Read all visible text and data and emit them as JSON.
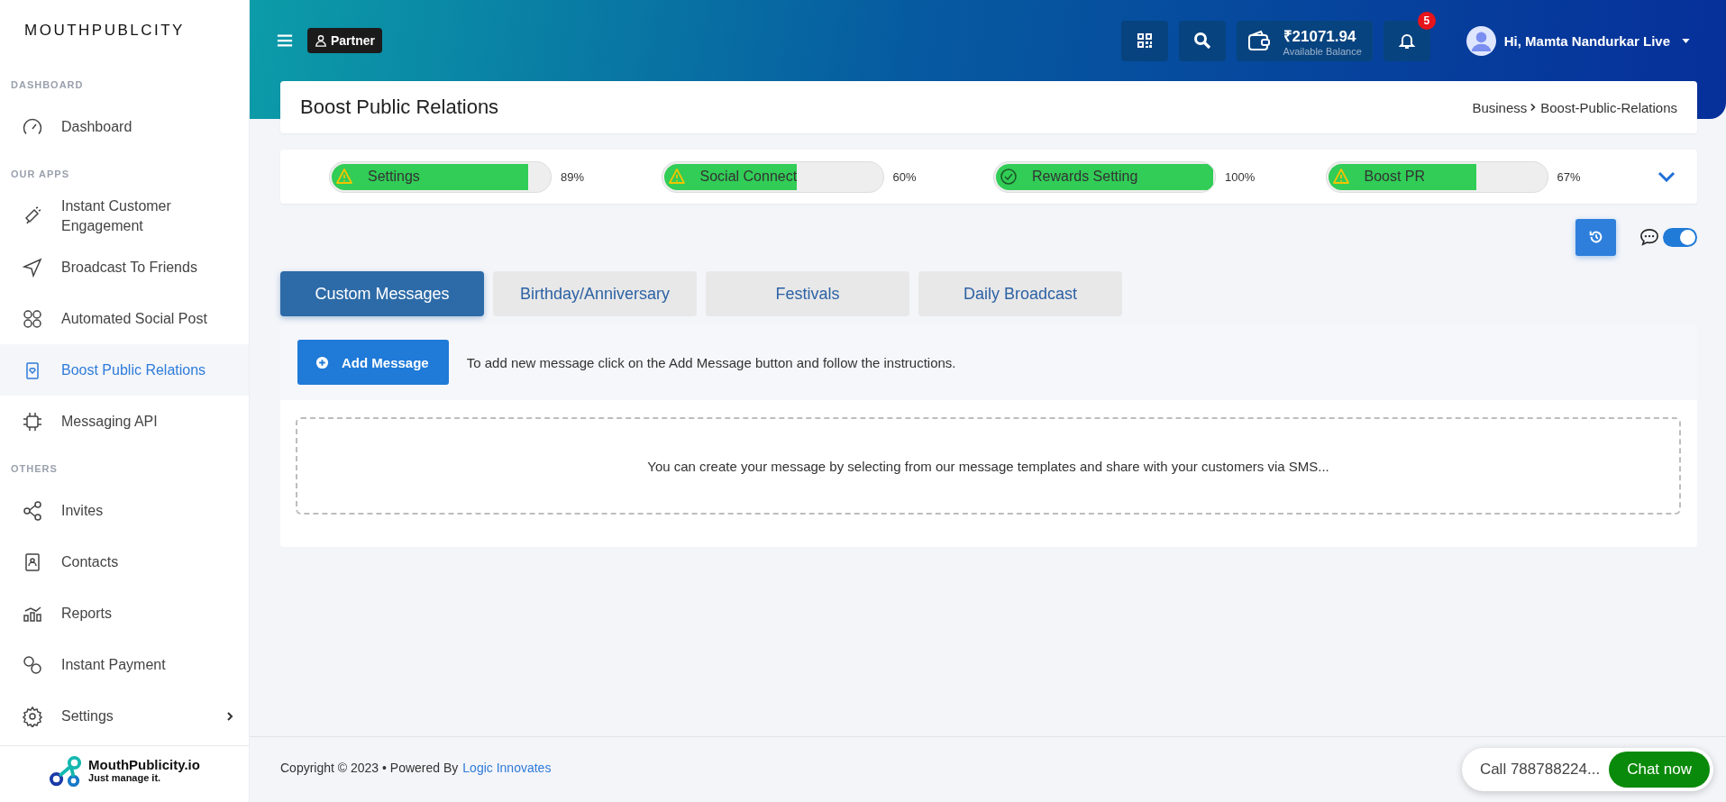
{
  "sidebar": {
    "logo": "MOUTHPUBLCITY",
    "sections": [
      {
        "heading": "DASHBOARD",
        "items": [
          {
            "label": "Dashboard",
            "selected": false,
            "submenu": false
          }
        ]
      },
      {
        "heading": "OUR APPS",
        "items": [
          {
            "label": "Instant Customer Engagement",
            "selected": false,
            "submenu": false
          },
          {
            "label": "Broadcast To Friends",
            "selected": false,
            "submenu": false
          },
          {
            "label": "Automated Social Post",
            "selected": false,
            "submenu": false
          },
          {
            "label": "Boost Public Relations",
            "selected": true,
            "submenu": false
          },
          {
            "label": "Messaging API",
            "selected": false,
            "submenu": false
          }
        ]
      },
      {
        "heading": "OTHERS",
        "items": [
          {
            "label": "Invites",
            "selected": false,
            "submenu": false
          },
          {
            "label": "Contacts",
            "selected": false,
            "submenu": false
          },
          {
            "label": "Reports",
            "selected": false,
            "submenu": false
          },
          {
            "label": "Instant Payment",
            "selected": false,
            "submenu": false
          },
          {
            "label": "Settings",
            "selected": false,
            "submenu": true
          }
        ]
      }
    ],
    "brand": {
      "name": "MouthPublicity.io",
      "tagline": "Just manage it."
    }
  },
  "topbar": {
    "badge": "Partner",
    "balance": "₹21071.94",
    "balance_label": "Available Balance",
    "notifications": "5",
    "user": "Hi, Mamta Nandurkar Live"
  },
  "page": {
    "title": "Boost Public Relations",
    "breadcrumb": [
      "Business",
      "Boost-Public-Relations"
    ]
  },
  "progress": [
    {
      "label": "Settings",
      "level": 0.89,
      "reading": "89%",
      "kind": "warning"
    },
    {
      "label": "Social Connect",
      "level": 0.6,
      "reading": "60%",
      "kind": "warning"
    },
    {
      "label": "Rewards Setting",
      "level": 1,
      "reading": "100%",
      "kind": "done"
    },
    {
      "label": "Boost PR",
      "level": 0.67,
      "reading": "67%",
      "kind": "warning"
    }
  ],
  "chat_toggle": {
    "on": true
  },
  "tabs": [
    {
      "label": "Custom Messages",
      "selected": true
    },
    {
      "label": "Birthday/Anniversary",
      "selected": false
    },
    {
      "label": "Festivals",
      "selected": false
    },
    {
      "label": "Daily Broadcast",
      "selected": false
    }
  ],
  "panel": {
    "button": "Add Message",
    "hint": "To add new message click on the Add Message button and follow the instructions.",
    "empty_text": "You can create your message by selecting from our message templates and share with your customers via SMS..."
  },
  "footer": {
    "copyright": "Copyright © 2023  • Powered By",
    "link": "Logic Innovates"
  },
  "chat_widget": {
    "call": "Call 788788224...",
    "button": "Chat now"
  }
}
